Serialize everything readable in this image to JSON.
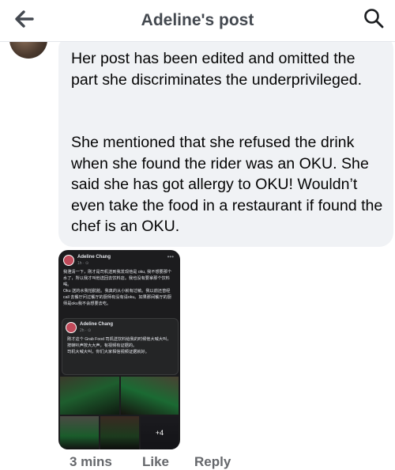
{
  "header": {
    "title": "Adeline's post",
    "back_icon": "arrow-left-icon",
    "search_icon": "search-icon"
  },
  "comment": {
    "paragraph_1": "Her post has been edited and omitted the part she discriminates the underprivileged.",
    "paragraph_2": "She mentioned that she refused the drink when she found the rider was an OKU. She said she has got allergy to OKU! Wouldn’t even take the food in a restaurant if found the chef is an OKU."
  },
  "attachment": {
    "author": "Adeline Chang",
    "time": "1h · ⊙",
    "text": "我澄清一下，刚才是司机送到我发现他是 oku, 我不想要那个水了，所以我才叫他送回去饮料店。我也没有要拿那个饮料喝。\nOku 送的水我怕肮脏。我真的从小就有过敏。我以前还曾经 call 去餐厅问过餐厅的厨师有没有请oku。如果那间餐厅的厨师是oku我不会想要去吃。",
    "shared_author": "Adeline Chang",
    "shared_time": "2h · ⊙",
    "shared_text": "刚才这个 Grab Food 司机送饮料给我的时候他大喊大叫，按喇叭声按大大声，有视频有证据的。\n司机大喊大叫，你们大家相信视频证据就好。",
    "more_photos": "+4"
  },
  "actions": {
    "time": "3 mins",
    "like": "Like",
    "reply": "Reply"
  }
}
